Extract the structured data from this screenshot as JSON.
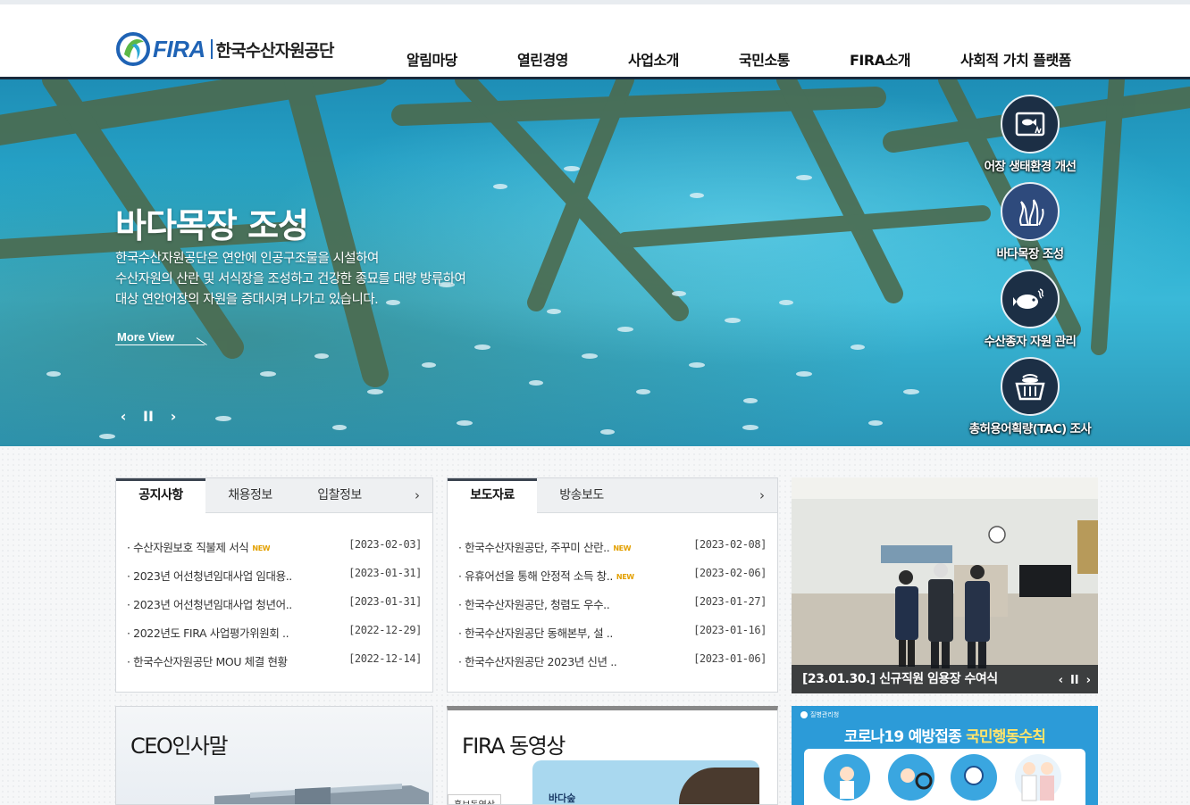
{
  "header": {
    "logo_fira": "FIRA",
    "logo_kor": "한국수산자원공단",
    "nav": [
      "알림마당",
      "열린경영",
      "사업소개",
      "국민소통",
      "FIRA소개",
      "사회적 가치 플랫폼"
    ]
  },
  "hero": {
    "title": "바다목장 조성",
    "desc": [
      "한국수산자원공단은 연안에 인공구조물을 시설하여",
      "수산자원의 산란 및 서식장을 조성하고 건강한 종묘를 대량 방류하여",
      "대상 연안어장의 자원을 증대시켜 나가고 있습니다."
    ],
    "more_label": "More View",
    "controls": [
      "‹",
      "II",
      "›"
    ],
    "quick_menu": [
      {
        "label": "어장 생태환경 개선",
        "icon": "fish-ecosystem-icon"
      },
      {
        "label": "바다목장 조성",
        "icon": "seaweed-icon"
      },
      {
        "label": "수산종자 자원 관리",
        "icon": "fish-seed-icon"
      },
      {
        "label": "총허용어획량(TAC) 조사",
        "icon": "fish-basket-icon"
      }
    ]
  },
  "notice_board": {
    "tabs": [
      "공지사항",
      "채용정보",
      "입찰정보"
    ],
    "more": "›",
    "rows": [
      {
        "title": "수산자원보호 직불제 서식",
        "new": true,
        "date": "[2023-02-03]"
      },
      {
        "title": "2023년 어선청년임대사업 임대용..",
        "new": false,
        "date": "[2023-01-31]"
      },
      {
        "title": "2023년 어선청년임대사업 청년어..",
        "new": false,
        "date": "[2023-01-31]"
      },
      {
        "title": "2022년도 FIRA 사업평가위원회 ..",
        "new": false,
        "date": "[2022-12-29]"
      },
      {
        "title": "한국수산자원공단 MOU 체결 현황",
        "new": false,
        "date": "[2022-12-14]"
      }
    ]
  },
  "press_board": {
    "tabs": [
      "보도자료",
      "방송보도"
    ],
    "more": "›",
    "rows": [
      {
        "title": "한국수산자원공단, 주꾸미 산란..",
        "new": true,
        "date": "[2023-02-08]"
      },
      {
        "title": "유휴어선을 통해 안정적 소득 창..",
        "new": true,
        "date": "[2023-02-06]"
      },
      {
        "title": "한국수산자원공단, 청렴도 우수..",
        "new": false,
        "date": "[2023-01-27]"
      },
      {
        "title": "한국수산자원공단 동해본부, 설 ..",
        "new": false,
        "date": "[2023-01-16]"
      },
      {
        "title": "한국수산자원공단 2023년 신년 ..",
        "new": false,
        "date": "[2023-01-06]"
      }
    ]
  },
  "new_badge": "NEW",
  "photo_news": {
    "caption": "[23.01.30.] 신규직원 임용장 수여식",
    "controls": [
      "‹",
      "II",
      "›"
    ]
  },
  "ceo_card": {
    "title": "CEO인사말"
  },
  "video_card": {
    "title": "FIRA 동영상",
    "tag": "홍보동영상",
    "thumb_text": "바다숲"
  },
  "covid_banner": {
    "org": "질병관리청",
    "title_a": "코로나19 예방접종",
    "title_b": "국민행동수칙"
  },
  "colors": {
    "brand_blue": "#1f63b5",
    "nav_border": "#1a2a3c",
    "quick_bg": "#1c2f45",
    "covid_bg": "#2c9bd8"
  }
}
